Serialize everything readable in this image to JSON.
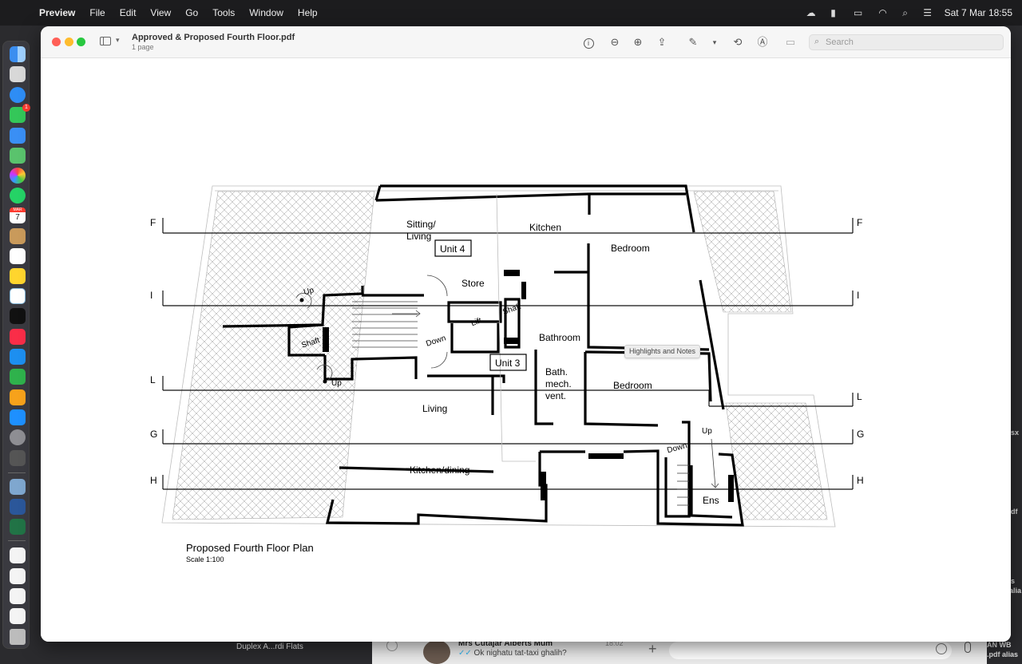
{
  "menubar": {
    "app_name": "Preview",
    "items": [
      "File",
      "Edit",
      "View",
      "Go",
      "Tools",
      "Window",
      "Help"
    ],
    "datetime": "Sat 7 Mar  18:55"
  },
  "window": {
    "doc_title": "Approved & Proposed Fourth Floor.pdf",
    "doc_subtitle": "1 page",
    "search_placeholder": "Search"
  },
  "tooltip": "Highlights and Notes",
  "plan": {
    "title": "Proposed Fourth Floor Plan",
    "scale": "Scale 1:100",
    "section_labels": [
      "F",
      "I",
      "L",
      "G",
      "H"
    ],
    "rooms": {
      "sitting_living": [
        "Sitting/",
        "Living"
      ],
      "kitchen": "Kitchen",
      "bedroom1": "Bedroom",
      "unit4": "Unit 4",
      "store": "Store",
      "lift": "Lift",
      "shaft1": "Shaft",
      "shaft2": "Shaft",
      "up1": "Up",
      "up2": "Up",
      "down1": "Down",
      "bathroom": "Bathroom",
      "unit3": "Unit 3",
      "bath_mech": [
        "Bath.",
        "mech.",
        "vent."
      ],
      "bedroom2": "Bedroom",
      "living": "Living",
      "up3": "Up",
      "down2": "Down",
      "kitchen_dining": "Kitchen/dining",
      "ens": "Ens"
    }
  },
  "dock": {
    "calendar_month": "MAR",
    "calendar_day": "7",
    "messages_badge": "1"
  },
  "below": {
    "folder_label": "Duplex A...rdi Flats",
    "chat_name": "Mrs Cutajar Alberts Mum",
    "chat_message": "Ok nighatu tat-taxi ghalih?",
    "chat_time": "18:02",
    "peek_1": "sx",
    "peek_2": "df",
    "peek_3": "s",
    "peek_4": "alia",
    "peek_5": "AN WB",
    "peek_6": ".pdf alias"
  },
  "colors": {
    "menubar_bg": "#1c1c1e",
    "window_bg": "#ffffff",
    "close": "#ff5f57",
    "minimize": "#febc2e",
    "maximize": "#28c840"
  }
}
